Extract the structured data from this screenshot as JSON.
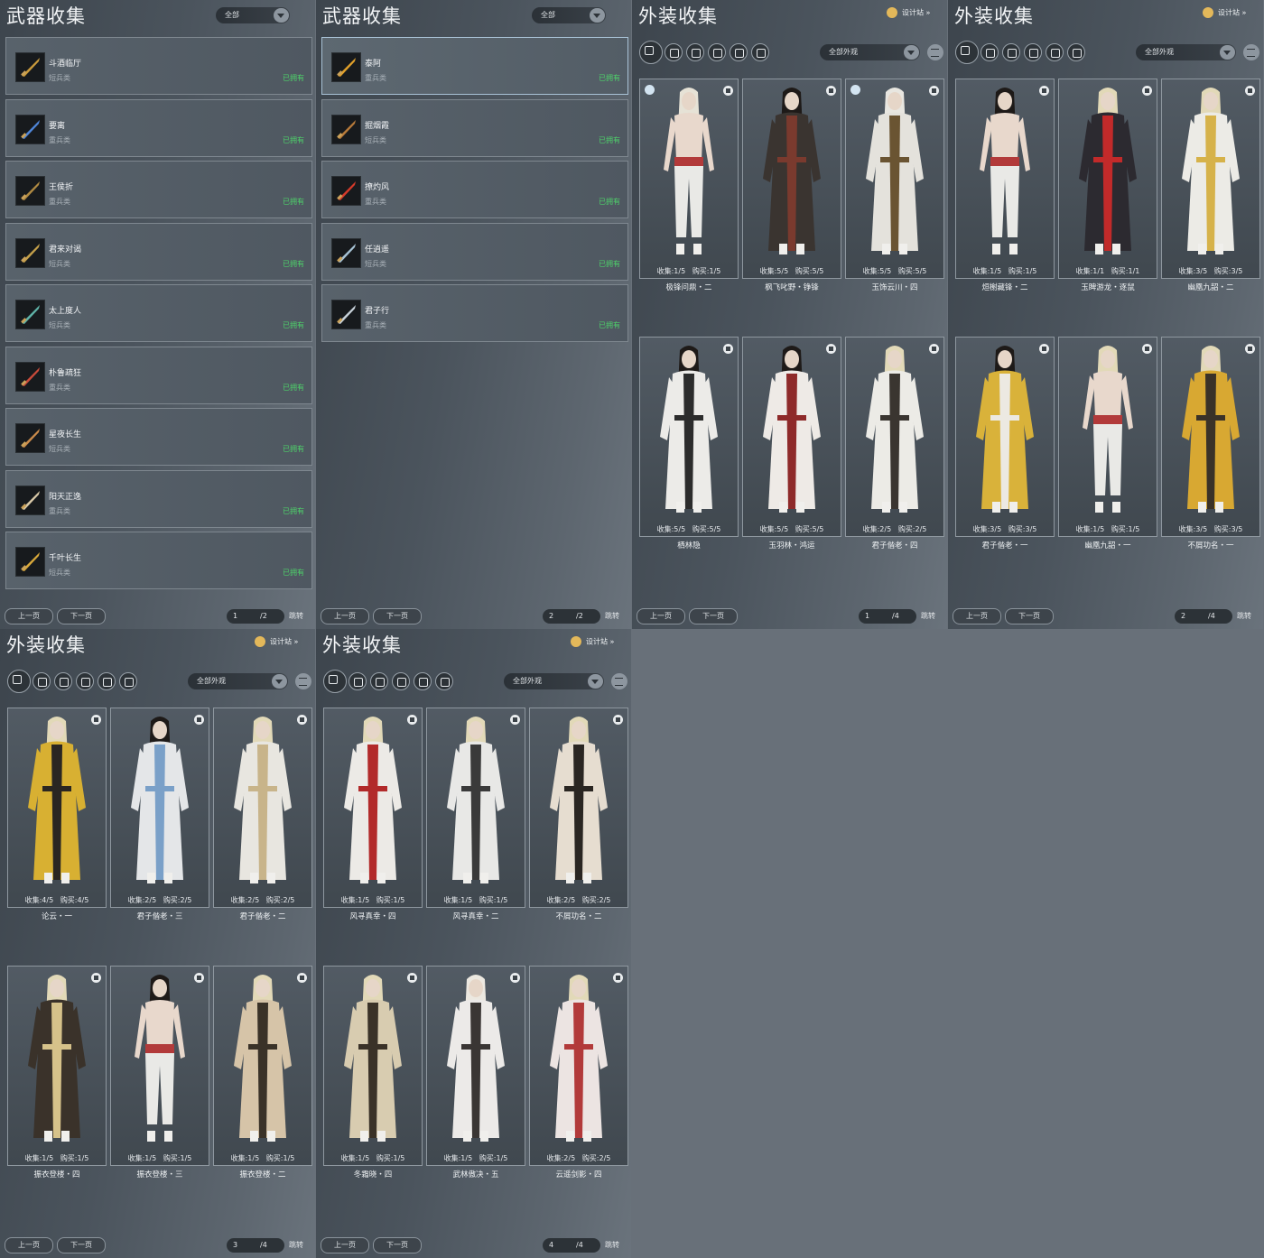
{
  "colors": {
    "owned": "#4ed26a",
    "panel_bg": "#4b545d",
    "page_bg": "#687079"
  },
  "weapon_panels": [
    {
      "title": "武器收集",
      "filter": "全部",
      "weapons": [
        {
          "name": "斗酒临厅",
          "type": "短兵类",
          "status": "已拥有",
          "color": "#c99a3c"
        },
        {
          "name": "要离",
          "type": "重兵类",
          "status": "已拥有",
          "color": "#4f86d9"
        },
        {
          "name": "王侯折",
          "type": "重兵类",
          "status": "已拥有",
          "color": "#b08a42"
        },
        {
          "name": "君来对谒",
          "type": "短兵类",
          "status": "已拥有",
          "color": "#c4a04a"
        },
        {
          "name": "太上度人",
          "type": "短兵类",
          "status": "已拥有",
          "color": "#5fb3a8"
        },
        {
          "name": "朴鲁疏狂",
          "type": "重兵类",
          "status": "已拥有",
          "color": "#c84a3a"
        },
        {
          "name": "星夜长生",
          "type": "短兵类",
          "status": "已拥有",
          "color": "#c98a4a"
        },
        {
          "name": "阳天正逸",
          "type": "重兵类",
          "status": "已拥有",
          "color": "#d9c9a8"
        },
        {
          "name": "千叶长生",
          "type": "短兵类",
          "status": "已拥有",
          "color": "#d8a83a"
        }
      ],
      "pager": {
        "prev": "上一页",
        "next": "下一页",
        "page": "1",
        "total": "/2",
        "jump": "跳转"
      }
    },
    {
      "title": "武器收集",
      "filter": "全部",
      "weapons": [
        {
          "name": "泰阿",
          "type": "重兵类",
          "status": "已拥有",
          "color": "#e0a02a"
        },
        {
          "name": "掘烟霞",
          "type": "短兵类",
          "status": "已拥有",
          "color": "#b77a3a"
        },
        {
          "name": "撩灼风",
          "type": "重兵类",
          "status": "已拥有",
          "color": "#d43a2a"
        },
        {
          "name": "任逍遥",
          "type": "短兵类",
          "status": "已拥有",
          "color": "#a7c3d6"
        },
        {
          "name": "君子行",
          "type": "重兵类",
          "status": "已拥有",
          "color": "#c8d2da"
        }
      ],
      "pager": {
        "prev": "上一页",
        "next": "下一页",
        "page": "2",
        "total": "/2",
        "jump": "跳转"
      }
    }
  ],
  "outfit_panels": [
    {
      "title": "外装收集",
      "design_label": "设计站",
      "filter": "全部外观",
      "items": [
        {
          "name": "极锋问鼎・二",
          "collect": "1/5",
          "buy": "1/5",
          "outfit": "#e9e9e6",
          "trim": "#b23a3a",
          "hair": "#e6e2d6",
          "shirtless": true,
          "badge": true
        },
        {
          "name": "枫飞叱野・铮锋",
          "collect": "5/5",
          "buy": "5/5",
          "outfit": "#3a3430",
          "trim": "#7a3a2e",
          "hair": "#1e1a18",
          "shirtless": false,
          "badge": false
        },
        {
          "name": "玉饰云川・四",
          "collect": "5/5",
          "buy": "5/5",
          "outfit": "#e4e2dc",
          "trim": "#6a5432",
          "hair": "#e8e6e0",
          "shirtless": false,
          "badge": true
        },
        {
          "name": "栖林隐",
          "collect": "5/5",
          "buy": "5/5",
          "outfit": "#ecebe8",
          "trim": "#2c2c2c",
          "hair": "#1e1a18",
          "shirtless": false,
          "badge": false
        },
        {
          "name": "玉羽林・鸿运",
          "collect": "5/5",
          "buy": "5/5",
          "outfit": "#eeeae6",
          "trim": "#8e2a2a",
          "hair": "#1e1a18",
          "shirtless": false,
          "badge": false
        },
        {
          "name": "君子偕老・四",
          "collect": "2/5",
          "buy": "2/5",
          "outfit": "#ecebe6",
          "trim": "#3a3530",
          "hair": "#e2d9b8",
          "shirtless": false,
          "badge": false
        }
      ],
      "pager": {
        "prev": "上一页",
        "next": "下一页",
        "page": "1",
        "total": "/4",
        "jump": "跳转"
      }
    },
    {
      "title": "外装收集",
      "design_label": "设计站",
      "filter": "全部外观",
      "items": [
        {
          "name": "烜榭藏锋・二",
          "collect": "1/5",
          "buy": "1/5",
          "outfit": "#e9e9e6",
          "trim": "#b23a3a",
          "hair": "#1e1a18",
          "shirtless": true,
          "badge": false
        },
        {
          "name": "玉睥游龙・逐鼠",
          "collect": "1/1",
          "buy": "1/1",
          "outfit": "#2c2a30",
          "trim": "#c22a2a",
          "hair": "#e2d9b8",
          "shirtless": false,
          "badge": false
        },
        {
          "name": "幽凰九韶・二",
          "collect": "3/5",
          "buy": "3/5",
          "outfit": "#ecebe6",
          "trim": "#d6b24a",
          "hair": "#e2d9b8",
          "shirtless": false,
          "badge": false
        },
        {
          "name": "君子偕老・一",
          "collect": "3/5",
          "buy": "3/5",
          "outfit": "#d9b23a",
          "trim": "#ece9e2",
          "hair": "#1e1a18",
          "shirtless": false,
          "badge": false
        },
        {
          "name": "幽凰九韶・一",
          "collect": "1/5",
          "buy": "1/5",
          "outfit": "#e9e9e6",
          "trim": "#b23a3a",
          "hair": "#e2d9b8",
          "shirtless": true,
          "badge": false
        },
        {
          "name": "不屑功名・一",
          "collect": "3/5",
          "buy": "3/5",
          "outfit": "#d8a832",
          "trim": "#3a3228",
          "hair": "#e2d9b8",
          "shirtless": false,
          "badge": false
        }
      ],
      "pager": {
        "prev": "上一页",
        "next": "下一页",
        "page": "2",
        "total": "/4",
        "jump": "跳转"
      }
    },
    {
      "title": "外装收集",
      "design_label": "设计站",
      "filter": "全部外观",
      "items": [
        {
          "name": "论云・一",
          "collect": "4/5",
          "buy": "4/5",
          "outfit": "#d8b032",
          "trim": "#2a2622",
          "hair": "#e2d9b8",
          "shirtless": false,
          "badge": false
        },
        {
          "name": "君子偕老・三",
          "collect": "2/5",
          "buy": "2/5",
          "outfit": "#e4e6e8",
          "trim": "#7aa0c8",
          "hair": "#1e1a18",
          "shirtless": false,
          "badge": false
        },
        {
          "name": "君子偕老・二",
          "collect": "2/5",
          "buy": "2/5",
          "outfit": "#e8e6e0",
          "trim": "#c8b48a",
          "hair": "#e2d9b8",
          "shirtless": false,
          "badge": false
        },
        {
          "name": "振衣登楼・四",
          "collect": "1/5",
          "buy": "1/5",
          "outfit": "#3a322a",
          "trim": "#d6c28a",
          "hair": "#e2d9b8",
          "shirtless": false,
          "badge": false
        },
        {
          "name": "振衣登楼・三",
          "collect": "1/5",
          "buy": "1/5",
          "outfit": "#e9e9e6",
          "trim": "#b23a3a",
          "hair": "#1e1a18",
          "shirtless": true,
          "badge": false
        },
        {
          "name": "振衣登楼・二",
          "collect": "1/5",
          "buy": "1/5",
          "outfit": "#d6c4a8",
          "trim": "#3a3228",
          "hair": "#e2d9b8",
          "shirtless": false,
          "badge": false
        }
      ],
      "pager": {
        "prev": "上一页",
        "next": "下一页",
        "page": "3",
        "total": "/4",
        "jump": "跳转"
      }
    },
    {
      "title": "外装收集",
      "design_label": "设计站",
      "filter": "全部外观",
      "items": [
        {
          "name": "风寻真幸・四",
          "collect": "1/5",
          "buy": "1/5",
          "outfit": "#eceae6",
          "trim": "#b22a2a",
          "hair": "#e2d9b8",
          "shirtless": false,
          "badge": false
        },
        {
          "name": "风寻真幸・二",
          "collect": "1/5",
          "buy": "1/5",
          "outfit": "#e8e8e6",
          "trim": "#3a3a3a",
          "hair": "#e2d9b8",
          "shirtless": false,
          "badge": false
        },
        {
          "name": "不屑功名・二",
          "collect": "2/5",
          "buy": "2/5",
          "outfit": "#e6ddd0",
          "trim": "#2a2622",
          "hair": "#e2d9b8",
          "shirtless": false,
          "badge": false
        },
        {
          "name": "冬霜晓・四",
          "collect": "1/5",
          "buy": "1/5",
          "outfit": "#d8ccb0",
          "trim": "#3a3228",
          "hair": "#e2d9b8",
          "shirtless": false,
          "badge": false
        },
        {
          "name": "武林傲决・五",
          "collect": "1/5",
          "buy": "1/5",
          "outfit": "#eceae8",
          "trim": "#3a3634",
          "hair": "#ece8e0",
          "shirtless": false,
          "badge": false
        },
        {
          "name": "云遥剑影・四",
          "collect": "2/5",
          "buy": "2/5",
          "outfit": "#ece4e2",
          "trim": "#b23a3a",
          "hair": "#e2d9b8",
          "shirtless": false,
          "badge": false
        }
      ],
      "pager": {
        "prev": "上一页",
        "next": "下一页",
        "page": "4",
        "total": "/4",
        "jump": "跳转"
      }
    }
  ],
  "labels": {
    "collect": "收集:",
    "buy": "购买:"
  },
  "icons": {
    "filter_tabs": [
      "all-icon",
      "top-icon",
      "trousers-icon",
      "hat-icon",
      "cape-icon",
      "scroll-icon"
    ],
    "design": "moon-icon",
    "list": "list-filter-icon",
    "trash": "trash-icon",
    "arrow": "chevron-down-icon"
  }
}
